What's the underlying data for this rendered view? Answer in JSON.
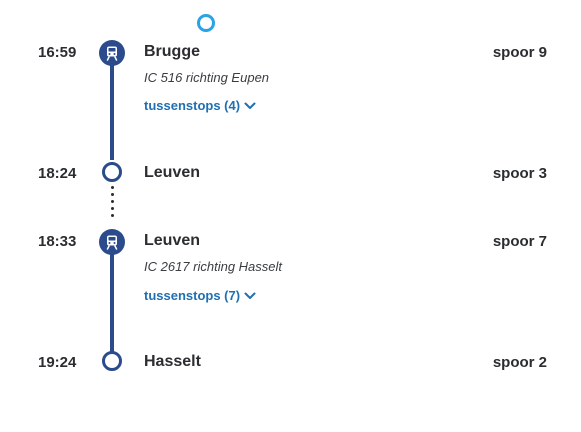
{
  "legs": [
    {
      "departure": {
        "time": "16:59",
        "station": "Brugge",
        "platform": "spoor 9"
      },
      "train": "IC 516 richting Eupen",
      "stops_link": "tussenstops (4)",
      "arrival": {
        "time": "18:24",
        "station": "Leuven",
        "platform": "spoor 3"
      }
    },
    {
      "departure": {
        "time": "18:33",
        "station": "Leuven",
        "platform": "spoor 7"
      },
      "train": "IC 2617 richting Hasselt",
      "stops_link": "tussenstops (7)",
      "arrival": {
        "time": "19:24",
        "station": "Hasselt",
        "platform": "spoor 2"
      }
    }
  ],
  "colors": {
    "line": "#2b4b8c",
    "link": "#1f6fb2",
    "current_marker": "#2aa2e6"
  },
  "icons": [
    "train-icon",
    "chevron-down-icon",
    "stop-circle-icon",
    "current-position-icon"
  ]
}
